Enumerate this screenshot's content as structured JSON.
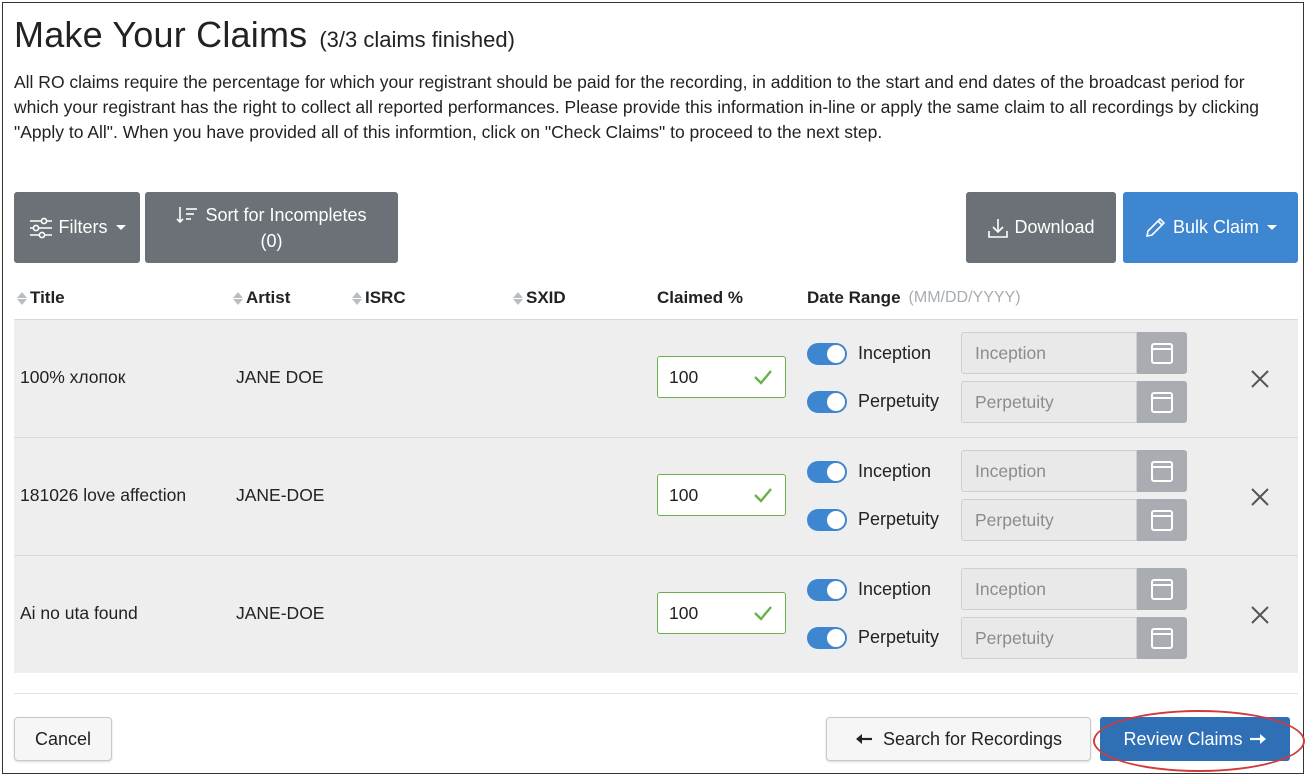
{
  "header": {
    "title": "Make Your Claims",
    "subtitle": "(3/3 claims finished)"
  },
  "intro": "All RO claims require the percentage for which your registrant should be paid for the recording, in addition to the start and end dates of the broadcast period for which your registrant has the right to collect all reported performances. Please provide this information in-line or apply the same claim to all recordings by clicking \"Apply to All\". When you have provided all of this informtion, click on \"Check Claims\" to proceed to the next step.",
  "toolbar": {
    "filters_label": "Filters",
    "sort_label_line1": "Sort for Incompletes",
    "sort_label_line2": "(0)",
    "download_label": "Download",
    "bulk_claim_label": "Bulk Claim"
  },
  "table": {
    "headers": {
      "title": "Title",
      "artist": "Artist",
      "isrc": "ISRC",
      "sxid": "SXID",
      "claimed": "Claimed %",
      "date_range": "Date Range",
      "date_format": "(MM/DD/YYYY)"
    },
    "rows": [
      {
        "title": "100% хлопок",
        "artist": "JANE DOE",
        "isrc": "",
        "sxid": "",
        "claimed": "100",
        "start_toggle": "Inception",
        "end_toggle": "Perpetuity",
        "start_placeholder": "Inception",
        "end_placeholder": "Perpetuity"
      },
      {
        "title": "181026 love affection",
        "artist": "JANE-DOE",
        "isrc": "",
        "sxid": "",
        "claimed": "100",
        "start_toggle": "Inception",
        "end_toggle": "Perpetuity",
        "start_placeholder": "Inception",
        "end_placeholder": "Perpetuity"
      },
      {
        "title": "Ai no uta found",
        "artist": "JANE-DOE",
        "isrc": "",
        "sxid": "",
        "claimed": "100",
        "start_toggle": "Inception",
        "end_toggle": "Perpetuity",
        "start_placeholder": "Inception",
        "end_placeholder": "Perpetuity"
      }
    ]
  },
  "footer": {
    "cancel_label": "Cancel",
    "search_label": "Search for Recordings",
    "review_label": "Review Claims"
  },
  "colors": {
    "primary_blue": "#3f86d1",
    "dark_gray": "#6b7176",
    "success_green": "#6ab04c",
    "highlight_red": "#d23b3b"
  },
  "icons": {
    "filters": "sliders-icon",
    "sort": "sort-descending-icon",
    "download": "download-icon",
    "bulk_claim": "pencil-icon",
    "check": "checkmark-icon",
    "calendar": "calendar-icon",
    "remove": "close-icon",
    "back": "arrow-left-icon",
    "forward": "arrow-right-icon"
  }
}
